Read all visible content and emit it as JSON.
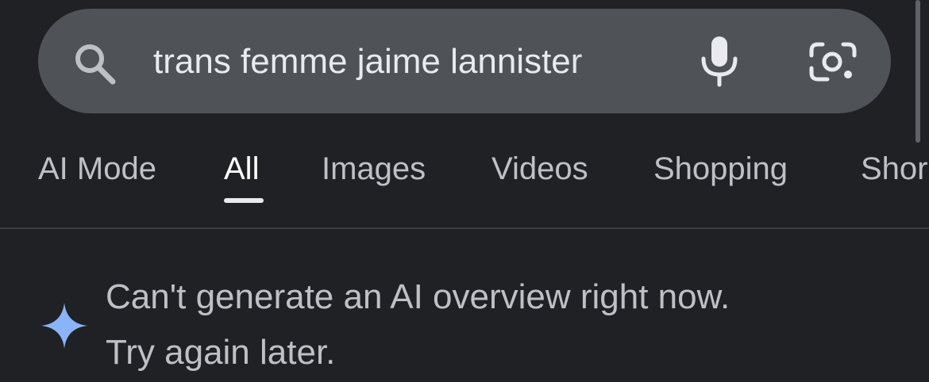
{
  "search": {
    "query": "trans femme jaime lannister",
    "icons": {
      "search": "search-icon",
      "voice": "mic-icon",
      "lens": "camera-lens-icon"
    }
  },
  "tabs": [
    {
      "label": "AI Mode",
      "active": false
    },
    {
      "label": "All",
      "active": true
    },
    {
      "label": "Images",
      "active": false
    },
    {
      "label": "Videos",
      "active": false
    },
    {
      "label": "Shopping",
      "active": false
    },
    {
      "label": "Shor",
      "active": false
    }
  ],
  "ai_overview": {
    "line1": "Can't generate an AI overview right now.",
    "line2": "Try again later.",
    "icon": "sparkle-icon"
  },
  "colors": {
    "background": "#202124",
    "search_bar": "#4f5257",
    "text": "#bdc1c6",
    "active_tab": "#ffffff",
    "sparkle": "#8ab4f8"
  }
}
